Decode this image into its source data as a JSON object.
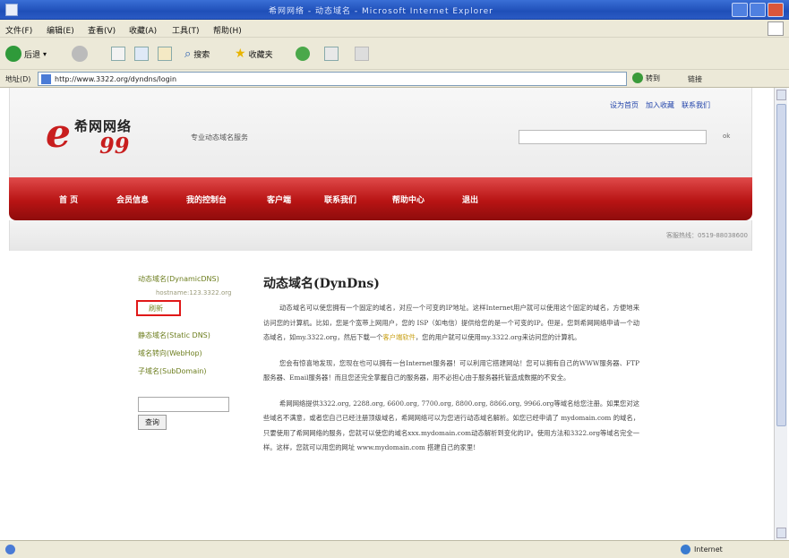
{
  "window": {
    "title": "希网网络 - 动态域名 - Microsoft Internet Explorer"
  },
  "menu": [
    "文件(F)",
    "编辑(E)",
    "查看(V)",
    "收藏(A)",
    "工具(T)",
    "帮助(H)"
  ],
  "toolbar": {
    "back_label": "后退",
    "search_label": "搜索",
    "favorites_label": "收藏夹"
  },
  "address": {
    "label": "地址(D)",
    "url": "http://www.3322.org/dyndns/login",
    "go_label": "转到",
    "links_label": "链接"
  },
  "status": {
    "zone_label": "Internet"
  },
  "site": {
    "logo_cn": "希网网络",
    "logo_num": "99",
    "tagline": "专业动态域名服务",
    "top_links": [
      "设为首页",
      "加入收藏",
      "联系我们"
    ],
    "search_btn": "ok",
    "nav": [
      "首 页",
      "会员信息",
      "我的控制台",
      "客户端",
      "联系我们",
      "帮助中心",
      "退出"
    ],
    "hotline": "客服热线：0519-88038600"
  },
  "sidebar": {
    "dynamic": "动态域名(DynamicDNS)",
    "host": "hostname:123.3322.org",
    "refresh": "刷新",
    "static": "静态域名(Static DNS)",
    "redirect": "域名转向(WebHop)",
    "subdomain": "子域名(SubDomain)",
    "query_btn": "查询"
  },
  "article": {
    "title": "动态域名(DynDns)",
    "p1": "动态域名可以使您拥有一个固定的域名，对应一个可变的IP地址。这样Internet用户就可以使用这个固定的域名，方便地来访问您的计算机。比如，您是个宽带上网用户，您的 ISP（如电信）提供给您的是一个可变的IP。但是，您到希网网络申请一个动态域名，如my.3322.org，然后下载一个",
    "p1_link": "客户端软件",
    "p1_tail": "，您的用户就可以使用my.3322.org来访问您的计算机。",
    "p2": "您会有惊喜地发现，您现在也可以拥有一台Internet服务器！可以利用它搭建网站！您可以拥有自己的WWW服务器、FTP服务器、Email服务器！而且您还完全掌握自己的服务器，用不必担心由于服务器托管造成数据的不安全。",
    "p3": "希网网络提供3322.org, 2288.org, 6600.org, 7700.org, 8800.org, 8866.org, 9966.org等域名给您注册。如果您对这些域名不满意，或者您自己已经注册顶级域名，希网网络可以为您进行动态域名解析。如您已经申请了 mydomain.com 的域名，只要使用了希网网络的服务，您就可以使您的域名xxx.mydomain.com动态解析到变化的IP。使用方法和3322.org等域名完全一样。这样，您就可以用您的网址 www.mydomain.com 搭建自己的家里!"
  }
}
